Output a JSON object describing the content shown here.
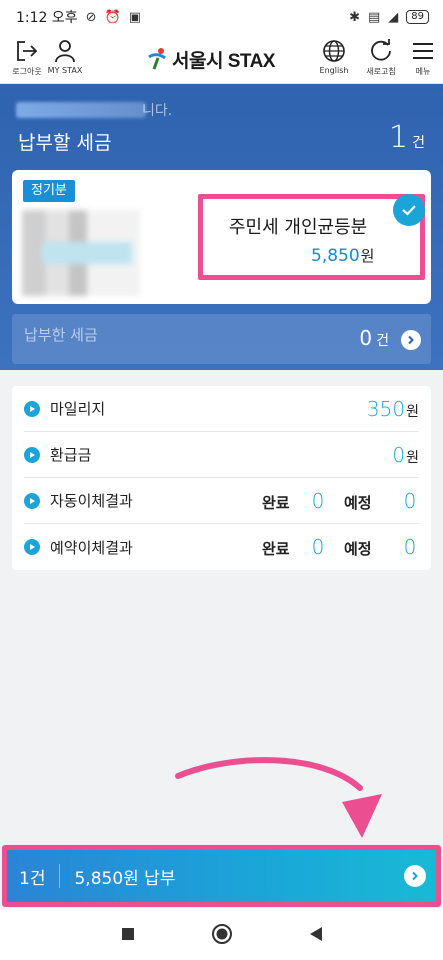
{
  "status_bar": {
    "time": "1:12 오후",
    "battery": "89"
  },
  "header": {
    "logout_label": "로그아웃",
    "mystax_label": "MY STAX",
    "logo_text": "서울시 STAX",
    "english_label": "English",
    "refresh_label": "새로고침",
    "menu_label": "메뉴"
  },
  "summary": {
    "greeting": "니다.",
    "title": "납부할 세금",
    "count": "1",
    "count_unit": "건"
  },
  "tax_card": {
    "tag": "정기분",
    "tax_name": "주민세 개인균등분",
    "amount": "5,850",
    "amount_unit": "원"
  },
  "paid": {
    "label": "납부한 세금",
    "count": "0",
    "count_unit": "건"
  },
  "info_list": {
    "mileage": {
      "label": "마일리지",
      "value": "350",
      "unit": "원"
    },
    "refund": {
      "label": "환급금",
      "value": "0",
      "unit": "원"
    },
    "autopay": {
      "label": "자동이체결과",
      "done_label": "완료",
      "done_value": "0",
      "sched_label": "예정",
      "sched_value": "0"
    },
    "reserved": {
      "label": "예약이체결과",
      "done_label": "완료",
      "done_value": "0",
      "sched_label": "예정",
      "sched_value": "0"
    }
  },
  "pay_bar": {
    "count": "1건",
    "label": "5,850원 납부"
  },
  "colors": {
    "header_blue": "#2f63b0",
    "accent_cyan": "#1ba4d8",
    "highlight_pink": "#ec4e92"
  },
  "icons": [
    "logout-icon",
    "user-icon",
    "globe-icon",
    "refresh-icon",
    "menu-icon",
    "check-icon",
    "chevron-right-icon",
    "play-dot-icon",
    "nav-recents-icon",
    "nav-home-icon",
    "nav-back-icon"
  ]
}
